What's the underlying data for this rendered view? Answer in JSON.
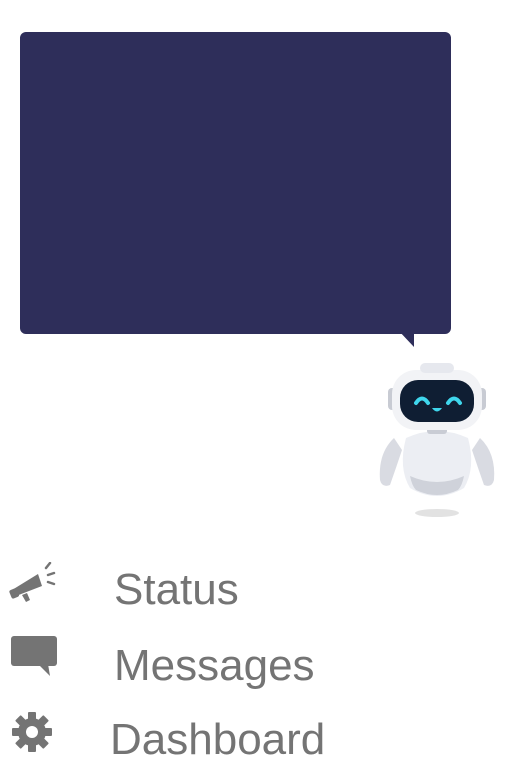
{
  "colors": {
    "bubble": "#2e2e5a",
    "menu_text": "#747474",
    "menu_icon": "#747474",
    "robot_face": "#0f1e33",
    "robot_eyes": "#3fd6ec"
  },
  "speech_bubble": {
    "text": ""
  },
  "assistant": {
    "icon": "robot-mascot"
  },
  "menu": {
    "items": [
      {
        "label": "Status",
        "icon": "megaphone-icon"
      },
      {
        "label": "Messages",
        "icon": "chat-bubble-icon"
      },
      {
        "label": "Dashboard",
        "icon": "gear-icon"
      }
    ]
  }
}
